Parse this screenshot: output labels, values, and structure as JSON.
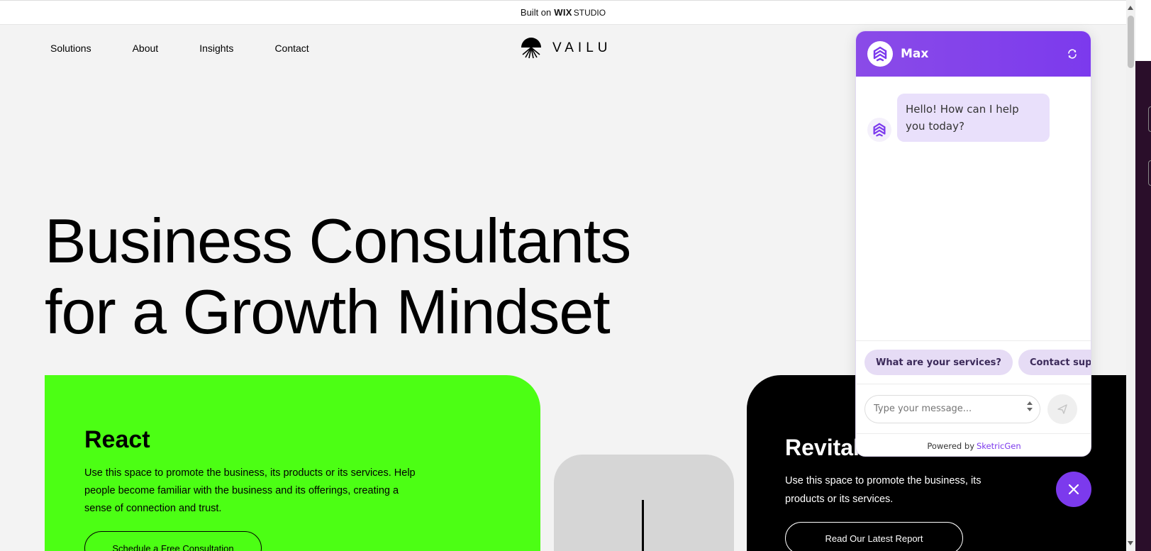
{
  "topbar": {
    "prefix": "Built on",
    "brand": "WIX",
    "product": "STUDIO"
  },
  "nav": {
    "items": [
      {
        "label": "Solutions"
      },
      {
        "label": "About"
      },
      {
        "label": "Insights"
      },
      {
        "label": "Contact"
      }
    ]
  },
  "logo": {
    "text": "VAILU"
  },
  "hero": {
    "line1": "Business Consultants",
    "line2": "for a Growth Mindset"
  },
  "card_react": {
    "title": "React",
    "text": "Use this space to promote the business, its products or its services. Help people become familiar with the business and its offerings, creating a sense of connection and trust.",
    "cta": "Schedule a Free Consultation",
    "color": "#4cff14"
  },
  "card_revitalize": {
    "title": "Revitalize",
    "text": "Use this space to promote the business, its products or its services.",
    "cta": "Read Our Latest Report"
  },
  "chat": {
    "bot_name": "Max",
    "accent": "#7c3aed",
    "greeting": "Hello! How can I help you today?",
    "suggestions": [
      "What are your services?",
      "Contact support"
    ],
    "input_placeholder": "Type your message...",
    "footer_prefix": "Powered by",
    "footer_brand": "SketricGen"
  },
  "icons": {
    "refresh": "refresh-icon",
    "send": "send-icon",
    "close": "close-icon",
    "bot": "bot-logo-icon"
  }
}
